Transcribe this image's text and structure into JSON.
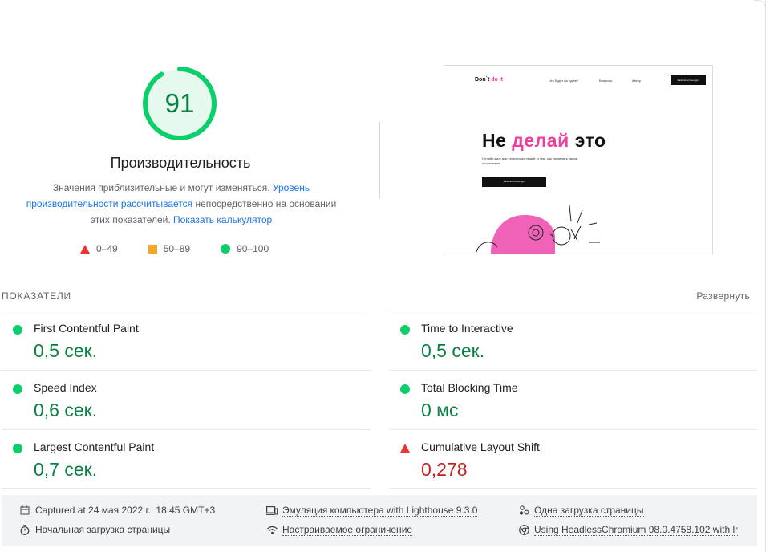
{
  "score": {
    "value": "91",
    "fraction": 0.91,
    "color": "#0cce6b"
  },
  "performance": {
    "title": "Производительность",
    "desc_part1": "Значения приблизительные и могут изменяться. ",
    "desc_link1": "Уровень производительности рассчитывается",
    "desc_part2": " непосредственно на основании этих показателей. ",
    "desc_link2": "Показать калькулятор"
  },
  "legend": [
    {
      "range": "0–49",
      "shape": "triangle",
      "color": "#e8372f"
    },
    {
      "range": "50–89",
      "shape": "square",
      "color": "#f5a623"
    },
    {
      "range": "90–100",
      "shape": "circle",
      "color": "#0cce6b"
    }
  ],
  "screenshot": {
    "logo_a": "Don`t ",
    "logo_b": "do it",
    "nav": [
      "Что будет на курсе?",
      "Вопросы",
      "Автор"
    ],
    "nav_button": "Записаться на курс",
    "headline_a": "Не ",
    "headline_b": "делай",
    "headline_c": " это",
    "subtitle": "Онлайн-курс для творческих людей, о том, как управлять своим организмом",
    "cta": "Записаться на курс"
  },
  "metrics": {
    "label": "ПОКАЗАТЕЛИ",
    "expand": "Развернуть",
    "items": [
      {
        "name": "First Contentful Paint",
        "value": "0,5 сек.",
        "status": "pass"
      },
      {
        "name": "Time to Interactive",
        "value": "0,5 сек.",
        "status": "pass"
      },
      {
        "name": "Speed Index",
        "value": "0,6 сек.",
        "status": "pass"
      },
      {
        "name": "Total Blocking Time",
        "value": "0 мс",
        "status": "pass"
      },
      {
        "name": "Largest Contentful Paint",
        "value": "0,7 сек.",
        "status": "pass"
      },
      {
        "name": "Cumulative Layout Shift",
        "value": "0,278",
        "status": "fail"
      }
    ]
  },
  "footer": {
    "captured": "Captured at 24 мая 2022 г., 18:45 GMT+3",
    "initial_load": "Начальная загрузка страницы",
    "emulation": "Эмуляция компьютера with Lighthouse 9.3.0",
    "throttling": "Настраиваемое ограничение",
    "single_load": "Одна загрузка страницы",
    "browser": "Using HeadlessChromium 98.0.4758.102 with lr"
  }
}
